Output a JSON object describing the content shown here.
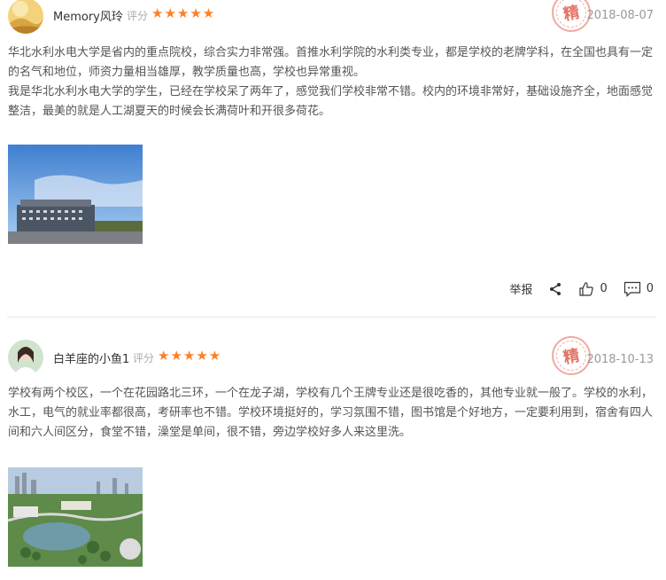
{
  "reviews": [
    {
      "username": "Memory风玲",
      "rating_label": "评分",
      "rating": 5,
      "stars": "★★★★★",
      "seal": "精",
      "date": "2018-08-07",
      "paragraphs": [
        "华北水利水电大学是省内的重点院校，综合实力非常强。首推水利学院的水利类专业，都是学校的老牌学科，在全国也具有一定的名气和地位，师资力量相当雄厚，教学质量也高，学校也异常重视。",
        "我是华北水利水电大学的学生，已经在学校呆了两年了，感觉我们学校非常不错。校内的环境非常好，基础设施齐全，地面感觉整洁，最美的就是人工湖夏天的时候会长满荷叶和开很多荷花。"
      ],
      "actions": {
        "report": "举报",
        "like_count": "0",
        "comment_count": "0"
      }
    },
    {
      "username": "白羊座的小鱼1",
      "rating_label": "评分",
      "rating": 5,
      "stars": "★★★★★",
      "seal": "精",
      "date": "2018-10-13",
      "paragraphs": [
        "学校有两个校区，一个在花园路北三环，一个在龙子湖，学校有几个王牌专业还是很吃香的，其他专业就一般了。学校的水利，水工，电气的就业率都很高，考研率也不错。学校环境挺好的，学习氛围不错，图书馆是个好地方，一定要利用到，宿舍有四人间和六人间区分，食堂不错，澡堂是单间，很不错，旁边学校好多人来这里洗。"
      ]
    }
  ]
}
